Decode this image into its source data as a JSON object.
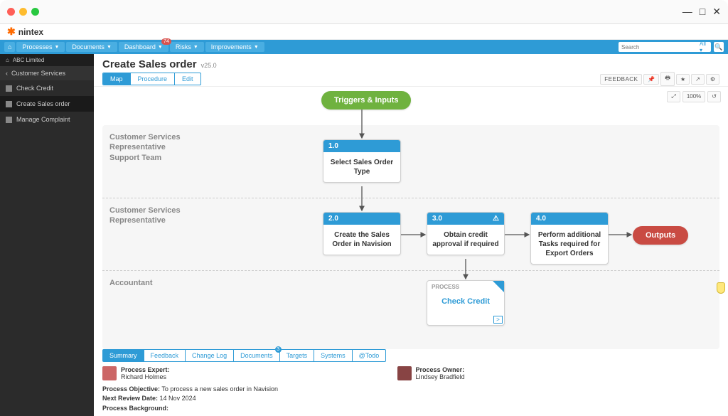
{
  "brand": "nintex",
  "window_controls": {
    "min": "—",
    "max": "□",
    "close": "✕"
  },
  "topnav": {
    "items": [
      "Processes",
      "Documents",
      "Dashboard",
      "Risks",
      "Improvements"
    ],
    "dashboard_badge": "74",
    "search_placeholder": "Search",
    "search_scope": "All",
    "home_icon": "⌂"
  },
  "sidebar": {
    "org": "ABC Limited",
    "back": "Customer Services",
    "items": [
      "Check Credit",
      "Create Sales order",
      "Manage Complaint"
    ],
    "active_index": 1
  },
  "page": {
    "title": "Create Sales order",
    "version": "v25.0"
  },
  "subtabs": [
    "Map",
    "Procedure",
    "Edit"
  ],
  "head_tools": {
    "feedback": "FEEDBACK",
    "zoom": "100%"
  },
  "lanes": [
    "Customer Services Representative Support Team",
    "Customer Services Representative",
    "Accountant"
  ],
  "triggers_label": "Triggers & Inputs",
  "outputs_label": "Outputs",
  "nodes": {
    "n1": {
      "num": "1.0",
      "text": "Select Sales Order Type"
    },
    "n2": {
      "num": "2.0",
      "text": "Create the Sales Order in Navision"
    },
    "n3": {
      "num": "3.0",
      "text": "Obtain credit approval if required",
      "warn": true
    },
    "n4": {
      "num": "4.0",
      "text": "Perform additional Tasks required for Export Orders"
    }
  },
  "subprocess": {
    "tag": "PROCESS",
    "title": "Check Credit",
    "link": ">"
  },
  "bottom_tabs": [
    "Summary",
    "Feedback",
    "Change Log",
    "Documents",
    "Targets",
    "Systems",
    "@Todo"
  ],
  "bottom_badge_index": 3,
  "bottom_badge": "3",
  "summary": {
    "expert_label": "Process Expert:",
    "expert_name": "Richard Holmes",
    "owner_label": "Process Owner:",
    "owner_name": "Lindsey Bradfield"
  },
  "meta": {
    "objective_label": "Process Objective:",
    "objective": "To process a new sales order in Navision",
    "review_label": "Next Review Date:",
    "review": "14 Nov 2024",
    "background_label": "Process Background:"
  }
}
